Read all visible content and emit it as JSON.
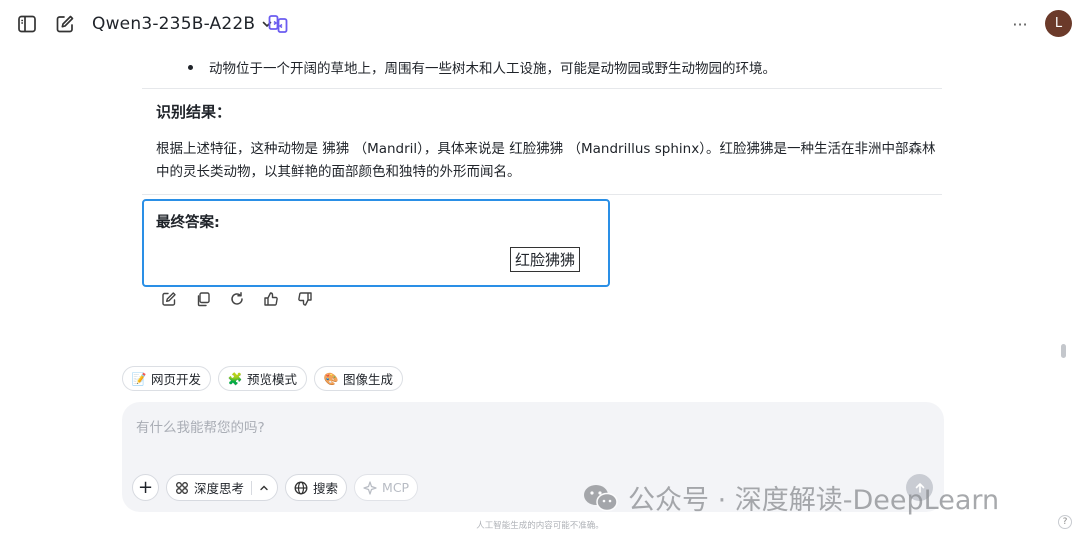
{
  "header": {
    "model_name": "Qwen3-235B-A22B",
    "more_label": "···",
    "avatar_initial": "L"
  },
  "conversation": {
    "bullet_text": "动物位于一个开阔的草地上，周围有一些树木和人工设施，可能是动物园或野生动物园的环境。",
    "result_heading": "识别结果：",
    "result_paragraph": "根据上述特征，这种动物是 狒狒 （Mandril），具体来说是 红脸狒狒 （Mandrillus sphinx）。红脸狒狒是一种生活在非洲中部森林中的灵长类动物，以其鲜艳的面部颜色和独特的外形而闻名。",
    "final_heading": "最终答案:",
    "final_answer": "红脸狒狒"
  },
  "message_actions": [
    "edit-icon",
    "copy-icon",
    "refresh-icon",
    "thumbs-up-icon",
    "thumbs-down-icon"
  ],
  "chips": [
    {
      "icon": "📝",
      "label": "网页开发"
    },
    {
      "icon": "🧩",
      "label": "预览模式"
    },
    {
      "icon": "🎨",
      "label": "图像生成"
    }
  ],
  "composer": {
    "placeholder": "有什么我能帮您的吗?",
    "plus_label": "+",
    "deep_think_label": "深度思考",
    "search_label": "搜索",
    "mcp_label": "MCP"
  },
  "watermark": "公众号 · 深度解读-DeepLearn",
  "disclaimer": "人工智能生成的内容可能不准确。",
  "help_label": "?",
  "colors": {
    "accent_border": "#2a8fe6",
    "compare_icon": "#6b5cf0",
    "avatar_bg": "#6b3a2a"
  }
}
